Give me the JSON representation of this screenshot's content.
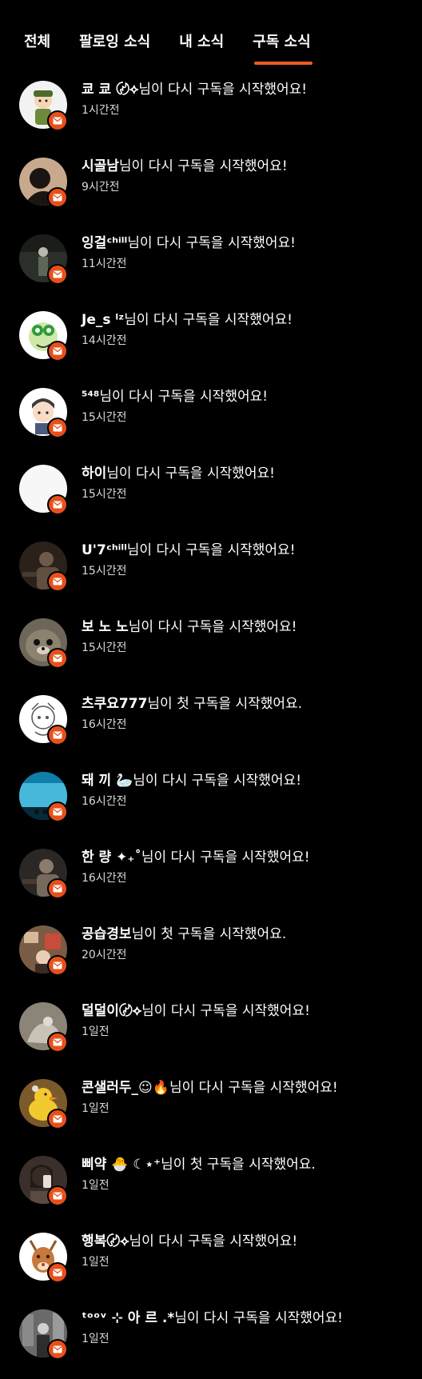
{
  "tabs": [
    {
      "label": "전체",
      "active": false
    },
    {
      "label": "팔로잉 소식",
      "active": false
    },
    {
      "label": "내 소식",
      "active": false
    },
    {
      "label": "구독 소식",
      "active": true
    }
  ],
  "colors": {
    "accent": "#f05a23",
    "badge": "#e8501b",
    "background": "#000000"
  },
  "notifications": [
    {
      "name": "쿄 쿄 〄⟡",
      "message": "님이 다시 구독을 시작했어요!",
      "time": "1시간전"
    },
    {
      "name": "시골남",
      "message": "님이 다시 구독을 시작했어요!",
      "time": "9시간전"
    },
    {
      "name": "잉걸ᶜʰⁱˡˡ",
      "message": "님이 다시 구독을 시작했어요!",
      "time": "11시간전"
    },
    {
      "name": "Je_s ˡᶻ",
      "message": "님이 다시 구독을 시작했어요!",
      "time": "14시간전"
    },
    {
      "name": "⁵⁴⁸",
      "message": "님이 다시 구독을 시작했어요!",
      "time": "15시간전"
    },
    {
      "name": "하이",
      "message": "님이 다시 구독을 시작했어요!",
      "time": "15시간전"
    },
    {
      "name": "U'7ᶜʰⁱˡˡ",
      "message": "님이 다시 구독을 시작했어요!",
      "time": "15시간전"
    },
    {
      "name": "보 노 노",
      "message": "님이 다시 구독을 시작했어요!",
      "time": "15시간전"
    },
    {
      "name": "츠쿠요777",
      "message": "님이 첫 구독을 시작했어요.",
      "time": "16시간전"
    },
    {
      "name": "돼 끼 🦢",
      "message": "님이 다시 구독을 시작했어요!",
      "time": "16시간전"
    },
    {
      "name": "한 량  ✦₊˚",
      "message": "님이 다시 구독을 시작했어요!",
      "time": "16시간전"
    },
    {
      "name": "공습경보",
      "message": "님이 첫 구독을 시작했어요.",
      "time": "20시간전"
    },
    {
      "name": "덜덜이〄⟡",
      "message": "님이 다시 구독을 시작했어요!",
      "time": "1일전"
    },
    {
      "name": "콘샐러두_☺🔥",
      "message": "님이 다시 구독을 시작했어요!",
      "time": "1일전"
    },
    {
      "name": "삐약     🐣 ☾⋆⁺",
      "message": "님이 첫 구독을 시작했어요.",
      "time": "1일전"
    },
    {
      "name": "행복〄⟡",
      "message": "님이 다시 구독을 시작했어요!",
      "time": "1일전"
    },
    {
      "name": "ᵗᵒᵒᵛ ⊹ 아 르 .*",
      "message": "님이 다시 구독을 시작했어요!",
      "time": "1일전"
    }
  ],
  "avatars": [
    {
      "icon": "cartoon-soldier-avatar",
      "bg": "#f2f2f2",
      "fg": "#6b8a3a"
    },
    {
      "icon": "shadow-portrait-avatar",
      "bg": "#c9a98d",
      "fg": "#1a1412"
    },
    {
      "icon": "night-street-avatar",
      "bg": "#2b2f2a",
      "fg": "#5d6659"
    },
    {
      "icon": "green-cartoon-avatar",
      "bg": "#ffffff",
      "fg": "#2f9d3b"
    },
    {
      "icon": "anime-boy-avatar",
      "bg": "#ffffff",
      "fg": "#3a3a3a"
    },
    {
      "icon": "blank-avatar",
      "bg": "#f7f7f7",
      "fg": "#f7f7f7"
    },
    {
      "icon": "dark-photo-avatar",
      "bg": "#2a211b",
      "fg": "#6e5a48"
    },
    {
      "icon": "seal-avatar",
      "bg": "#6e6658",
      "fg": "#d9d0bf"
    },
    {
      "icon": "sketch-character-avatar",
      "bg": "#ffffff",
      "fg": "#555555"
    },
    {
      "icon": "aquarium-avatar",
      "bg": "#0e7fa8",
      "fg": "#5fd0f0"
    },
    {
      "icon": "dark-photo-avatar",
      "bg": "#2b2724",
      "fg": "#8a7b6b"
    },
    {
      "icon": "room-photo-avatar",
      "bg": "#7a5c45",
      "fg": "#d8b89a"
    },
    {
      "icon": "blurry-hand-avatar",
      "bg": "#8c8478",
      "fg": "#c9c2b6"
    },
    {
      "icon": "duck-avatar",
      "bg": "#7a5a2a",
      "fg": "#f2c92e"
    },
    {
      "icon": "mirror-selfie-avatar",
      "bg": "#3a2f2a",
      "fg": "#c7a38d"
    },
    {
      "icon": "deer-cartoon-avatar",
      "bg": "#ffffff",
      "fg": "#c9773a"
    },
    {
      "icon": "street-photo-avatar",
      "bg": "#6a6a6a",
      "fg": "#d0d0d0"
    }
  ]
}
